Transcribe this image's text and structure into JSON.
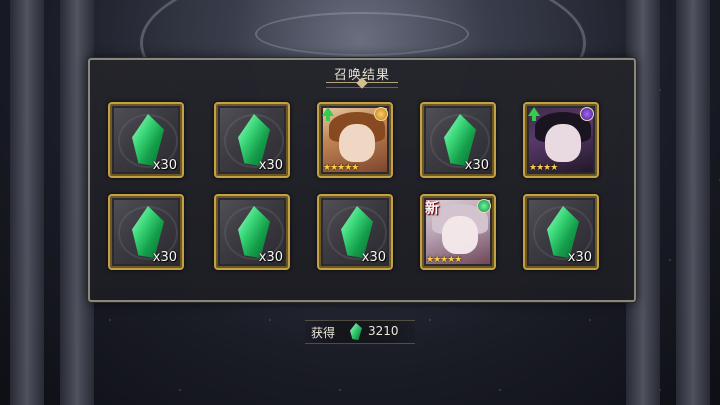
{
  "panel": {
    "title": "召唤结果"
  },
  "results": [
    {
      "type": "crystal",
      "qty": "x30"
    },
    {
      "type": "crystal",
      "qty": "x30"
    },
    {
      "type": "character",
      "stars": "★★★★★",
      "element": "sun-icon",
      "upgrade": true,
      "new": false
    },
    {
      "type": "crystal",
      "qty": "x30"
    },
    {
      "type": "character",
      "stars": "★★★★",
      "element": "moon-icon",
      "upgrade": true,
      "new": false
    },
    {
      "type": "crystal",
      "qty": "x30"
    },
    {
      "type": "crystal",
      "qty": "x30"
    },
    {
      "type": "crystal",
      "qty": "x30"
    },
    {
      "type": "character",
      "stars": "★★★★★",
      "element": "wind-icon",
      "upgrade": false,
      "new": true,
      "new_label": "新"
    },
    {
      "type": "crystal",
      "qty": "x30"
    }
  ],
  "footer": {
    "label": "获得",
    "currency_icon": "crystal-icon",
    "value": "3210"
  },
  "colors": {
    "frame_gold": "#c9a545",
    "crystal_green": "#3ee07e",
    "panel_bg": "#1f2026"
  }
}
